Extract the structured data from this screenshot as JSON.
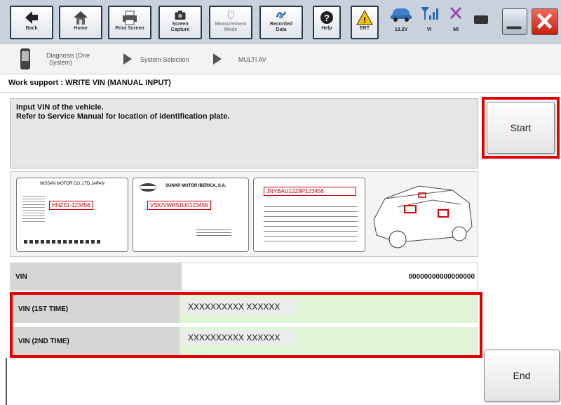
{
  "toolbar": {
    "back_label": "Back",
    "home_label": "Home",
    "print_label": "Print Screen",
    "capture_label_1": "Screen",
    "capture_label_2": "Capture",
    "measurement_label_1": "Measurement",
    "measurement_label_2": "Mode",
    "recorded_label_1": "Recorded",
    "recorded_label_2": "Data",
    "help_label": "Help",
    "ert_label": "ERT",
    "voltage_label": "13.2V",
    "vi_label": "VI",
    "mi_label": "MI"
  },
  "breadcrumb": {
    "item1_line1": "Diagnosis (One",
    "item1_line2": "System)",
    "item2": "System Selection",
    "item3": "MULTI AV"
  },
  "page_title": "Work support : WRITE VIN (MANUAL INPUT)",
  "instructions": {
    "line1": "Input VIN of the vehicle.",
    "line2": "Refer to Service Manual for location of identification plate."
  },
  "buttons": {
    "start_label": "Start",
    "end_label": "End"
  },
  "plates": {
    "plate1_header": "NISSAN MOTOR CO.,LTD.JAPAN",
    "plate1_vin": "HNZ51-123456",
    "plate2_header": "SUNAR MOTOR IBERICA, S.A.",
    "plate2_vin": "VSK/VWR51U0123456",
    "plate3_vin": "JNYBAU12Z8P123456"
  },
  "rows": {
    "vin_label": "VIN",
    "vin_value": "00000000000000000",
    "first_label": "VIN (1ST TIME)",
    "first_value": "XXXXXXXXXX XXXXXX",
    "second_label": "VIN (2ND TIME)",
    "second_value": "XXXXXXXXXX XXXXXX"
  },
  "colors": {
    "highlight": "#e00000",
    "entry_bg": "#dff5d6",
    "label_bg": "#d6d6d6"
  }
}
